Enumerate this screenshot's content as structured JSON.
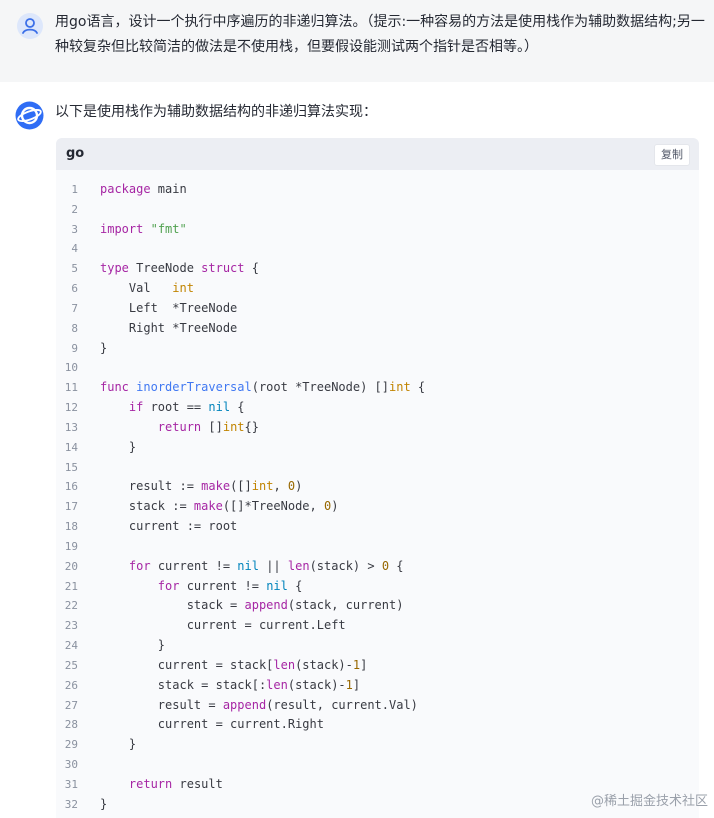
{
  "user_message": {
    "avatar_icon": "user-icon",
    "text": "用go语言，设计一个执行中序遍历的非递归算法。（提示:一种容易的方法是使用栈作为辅助数据结构;另一种较复杂但比较简洁的做法是不使用栈，但要假设能测试两个指针是否相等。）"
  },
  "assistant_message": {
    "avatar_icon": "ai-assistant-icon",
    "intro": "以下是使用栈作为辅助数据结构的非递归算法实现：",
    "code_block": {
      "language": "go",
      "copy_label": "复制",
      "lines": [
        "package main",
        "",
        "import \"fmt\"",
        "",
        "type TreeNode struct {",
        "    Val   int",
        "    Left  *TreeNode",
        "    Right *TreeNode",
        "}",
        "",
        "func inorderTraversal(root *TreeNode) []int {",
        "    if root == nil {",
        "        return []int{}",
        "    }",
        "",
        "    result := make([]int, 0)",
        "    stack := make([]*TreeNode, 0)",
        "    current := root",
        "",
        "    for current != nil || len(stack) > 0 {",
        "        for current != nil {",
        "            stack = append(stack, current)",
        "            current = current.Left",
        "        }",
        "        current = stack[len(stack)-1]",
        "        stack = stack[:len(stack)-1]",
        "        result = append(result, current.Val)",
        "        current = current.Right",
        "    }",
        "",
        "    return result",
        "}"
      ]
    }
  },
  "watermark": "@稀土掘金技术社区"
}
